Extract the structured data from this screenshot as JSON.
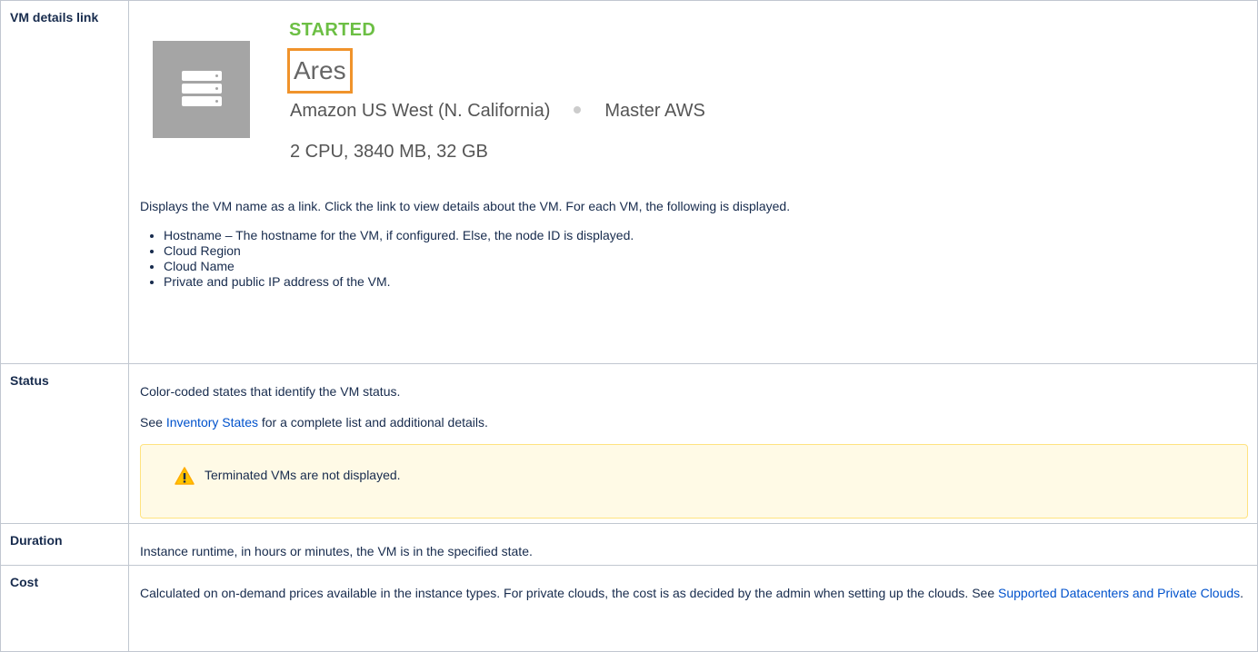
{
  "rows": [
    {
      "label": "VM details link",
      "vm": {
        "status": "STARTED",
        "status_color": "#6cbf44",
        "name": "Ares",
        "region": "Amazon US West (N. California)",
        "cloud": "Master AWS",
        "specs": "2 CPU, 3840 MB, 32 GB",
        "icon": "server-stack-icon"
      },
      "description": "Displays the VM name as a link. Click the link to view details about the VM. For each VM, the following is displayed.",
      "bullets": [
        "Hostname – The hostname for the VM, if configured. Else, the node ID is displayed.",
        "Cloud Region",
        "Cloud Name",
        "Private and public IP address of the VM."
      ]
    },
    {
      "label": "Status",
      "text1": "Color-coded states that identify the VM status.",
      "text2_prefix": "See ",
      "text2_link": "Inventory States",
      "text2_suffix": " for a complete list and additional details.",
      "note": "Terminated VMs are not displayed.",
      "note_icon": "warning-icon"
    },
    {
      "label": "Duration",
      "text": "Instance runtime, in hours or minutes, the VM is in the specified state."
    },
    {
      "label": "Cost",
      "text": "Calculated on on-demand prices available in the instance types. For private clouds, the cost is as decided by the admin when setting up the clouds. See ",
      "link": "Supported Datacenters and Private Clouds",
      "suffix": "."
    }
  ],
  "colors": {
    "link": "#0052cc",
    "accent_box": "#f0932b",
    "note_bg": "#fffae6"
  }
}
